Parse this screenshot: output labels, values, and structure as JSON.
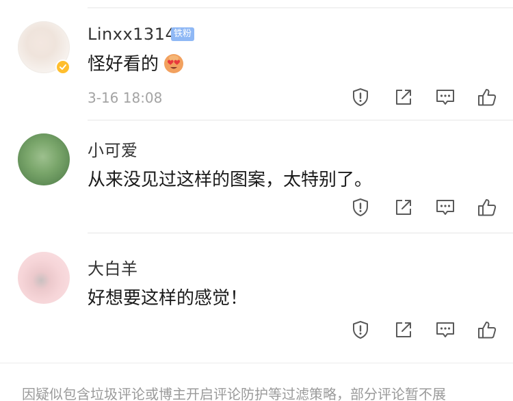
{
  "comments": [
    {
      "user": "Linxx1314",
      "badge": "铁粉",
      "verified": true,
      "text": "怪好看的",
      "emoji": "heart-eyes-emoji",
      "time": "3-16 18:08"
    },
    {
      "user": "小可爱",
      "text": "从来没见过这样的图案，太特别了。"
    },
    {
      "user": "大白羊",
      "text": "好想要这样的感觉！"
    }
  ],
  "actions": [
    "report-icon",
    "share-icon",
    "comment-icon",
    "like-icon"
  ],
  "colors": {
    "badge": "#8fb8f5",
    "verified": "#ffbe2e",
    "icon": "#595959",
    "muted": "#a3a3a3"
  },
  "footer": {
    "notice": "因疑似包含垃圾评论或博主开启评论防护等过滤策略，部分评论暂不展"
  }
}
